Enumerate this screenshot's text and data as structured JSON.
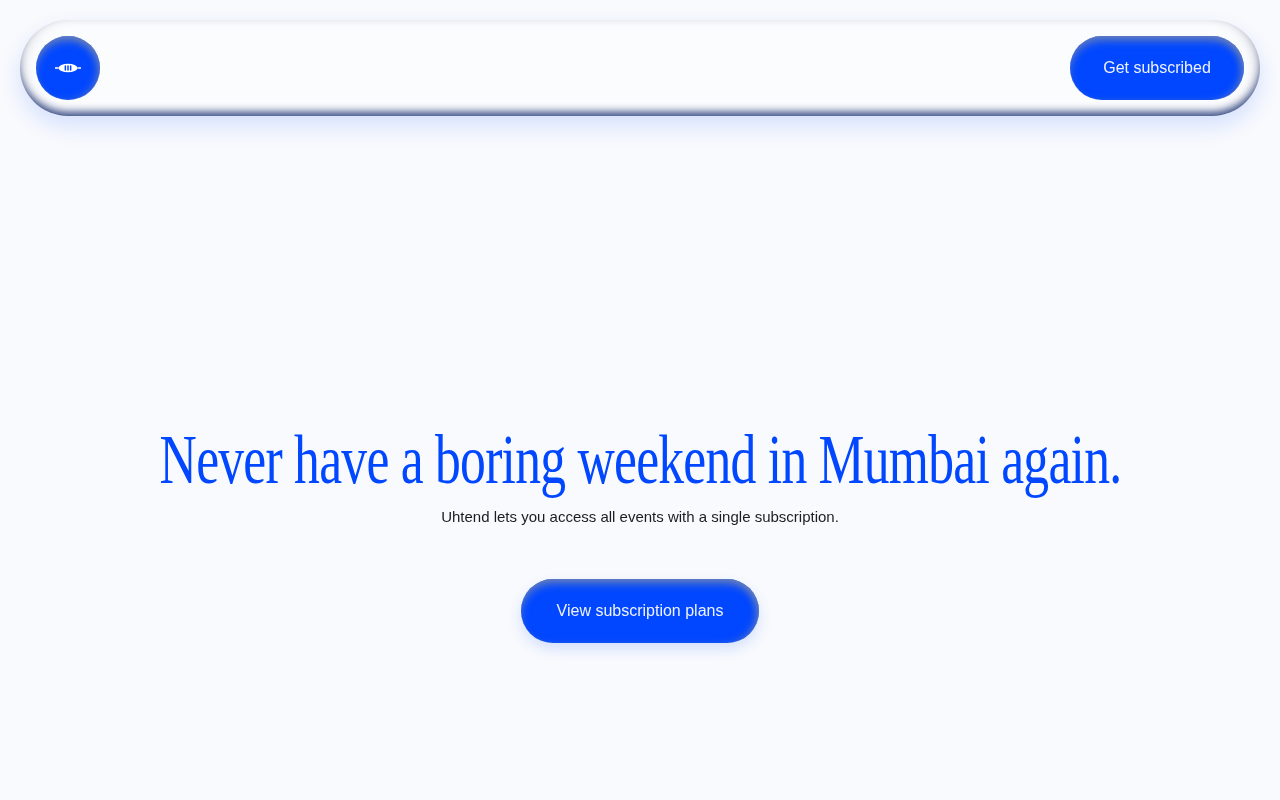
{
  "header": {
    "cta_button": "Get subscribed"
  },
  "hero": {
    "headline": "Never have a boring weekend in Mumbai again.",
    "subheadline": "Uhtend lets you access all events with a single subscription.",
    "button": "View subscription plans"
  }
}
